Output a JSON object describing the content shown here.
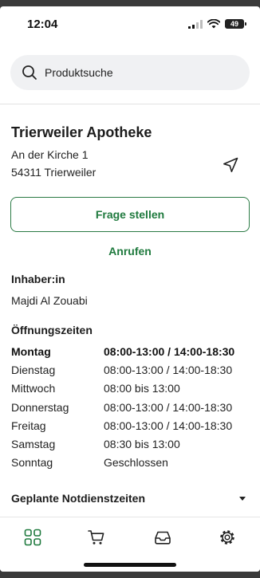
{
  "status_bar": {
    "time": "12:04",
    "battery": "49"
  },
  "search": {
    "placeholder": "Produktsuche"
  },
  "pharmacy": {
    "name": "Trierweiler Apotheke",
    "address_line1": "An der Kirche 1",
    "address_line2": "54311 Trierweiler"
  },
  "actions": {
    "ask_question": "Frage stellen",
    "call": "Anrufen"
  },
  "owner": {
    "heading": "Inhaber:in",
    "name": "Majdi Al Zouabi"
  },
  "opening_hours": {
    "heading": "Öffnungszeiten",
    "rows": [
      {
        "day": "Montag",
        "time": "08:00-13:00 / 14:00-18:30"
      },
      {
        "day": "Dienstag",
        "time": "08:00-13:00 / 14:00-18:30"
      },
      {
        "day": "Mittwoch",
        "time": "08:00 bis 13:00"
      },
      {
        "day": "Donnerstag",
        "time": "08:00-13:00 / 14:00-18:30"
      },
      {
        "day": "Freitag",
        "time": "08:00-13:00 / 14:00-18:30"
      },
      {
        "day": "Samstag",
        "time": "08:30 bis 13:00"
      },
      {
        "day": "Sonntag",
        "time": "Geschlossen"
      }
    ]
  },
  "emergency": {
    "label": "Geplante Notdienstzeiten"
  },
  "tabbar": {
    "items": [
      {
        "icon": "grid-icon",
        "active": true
      },
      {
        "icon": "cart-icon",
        "active": false
      },
      {
        "icon": "inbox-icon",
        "active": false
      },
      {
        "icon": "gear-icon",
        "active": false
      }
    ]
  },
  "colors": {
    "accent": "#1f7a3e",
    "search_bg": "#f0f1f3",
    "divider": "#e3e3e3"
  }
}
